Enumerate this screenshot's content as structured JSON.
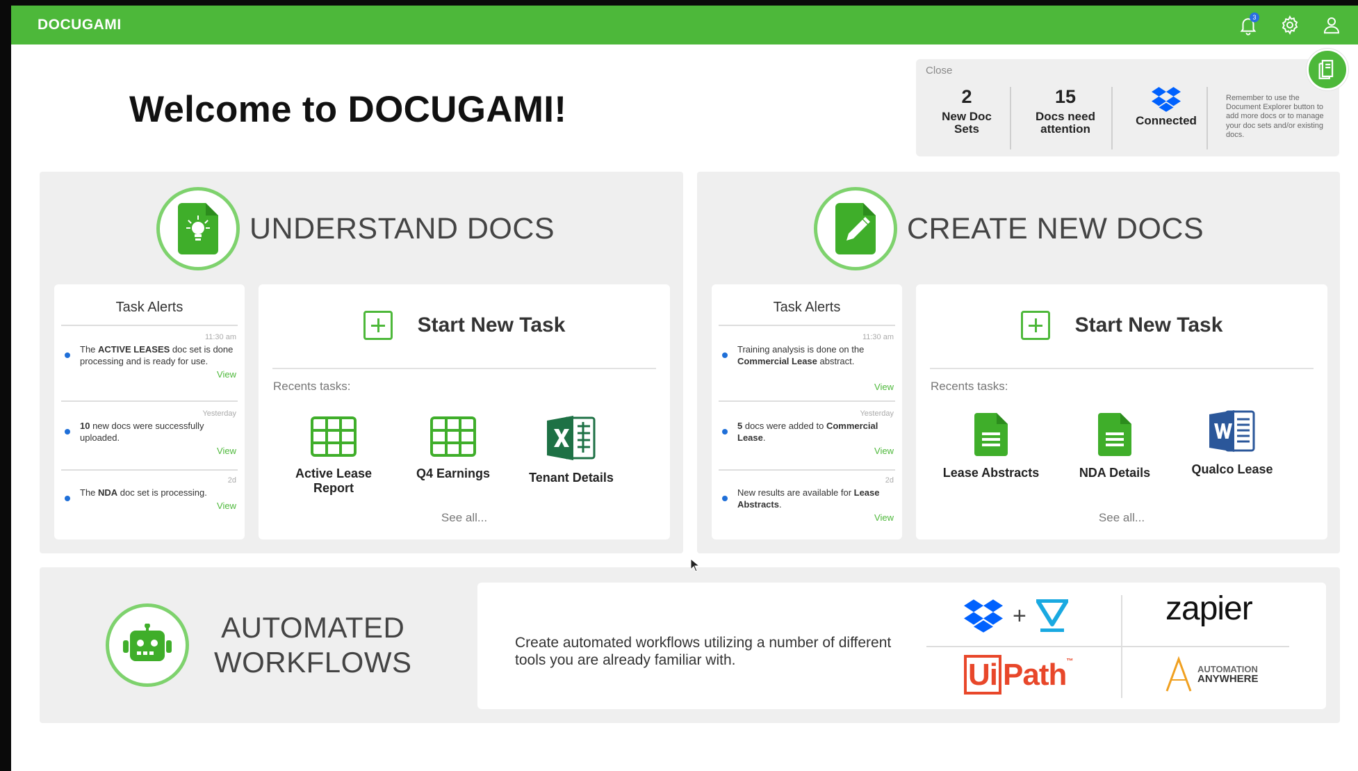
{
  "app": {
    "brand": "DOCUGAMI",
    "notification_count": "3"
  },
  "welcome": {
    "title": "Welcome to DOCUGAMI!"
  },
  "stats": {
    "close_label": "Close",
    "new_doc_sets": {
      "value": "2",
      "label": "New Doc Sets"
    },
    "docs_attention": {
      "value": "15",
      "label": "Docs need attention"
    },
    "dropbox": {
      "label": "Connected"
    },
    "note": "Remember to use the Document Explorer button to add more docs or to manage your doc sets and/or existing docs."
  },
  "understand": {
    "title": "UNDERSTAND DOCS",
    "alerts_title": "Task Alerts",
    "alerts": [
      {
        "time": "11:30 am",
        "pre": "The ",
        "bold": "ACTIVE LEASES",
        "post": " doc set is done processing and is ready for use.",
        "view": "View"
      },
      {
        "time": "Yesterday",
        "pre": "",
        "bold": "10",
        "post": " new docs were successfully uploaded.",
        "view": "View"
      },
      {
        "time": "2d",
        "pre": "The ",
        "bold": "NDA",
        "post": " doc set is processing.",
        "view": "View"
      }
    ],
    "start_label": "Start New Task",
    "recents_label": "Recents tasks:",
    "recents": [
      "Active Lease Report",
      "Q4 Earnings",
      "Tenant Details"
    ],
    "see_all": "See all..."
  },
  "create": {
    "title": "CREATE NEW DOCS",
    "alerts_title": "Task Alerts",
    "alerts": [
      {
        "time": "11:30 am",
        "pre": "Training analysis is done on the ",
        "bold": "Commercial Lease",
        "post": " abstract.",
        "view": "View"
      },
      {
        "time": "Yesterday",
        "pre": "",
        "bold": "5",
        "post": " docs were added to ",
        "bold2": "Commercial Lease",
        "post2": ".",
        "view": "View"
      },
      {
        "time": "2d",
        "pre": "New results are available for ",
        "bold": "Lease Abstracts",
        "post": ".",
        "view": "View"
      }
    ],
    "start_label": "Start New Task",
    "recents_label": "Recents tasks:",
    "recents": [
      "Lease Abstracts",
      "NDA Details",
      "Qualco Lease"
    ],
    "see_all": "See all..."
  },
  "automated": {
    "title_line1": "AUTOMATED",
    "title_line2": "WORKFLOWS",
    "description": "Create automated workflows utilizing a number of different tools you are already familiar with.",
    "logos": {
      "plus": "+",
      "zapier": "zapier",
      "uipath_ui": "Ui",
      "uipath_path": "Path",
      "uipath_tm": "™",
      "aa_line1": "AUTOMATION",
      "aa_line2": "ANYWHERE"
    }
  },
  "colors": {
    "brand_green": "#4db83a",
    "light_green": "#7ed26d",
    "bullet_blue": "#1f6fd8",
    "excel_green": "#1e7145",
    "word_blue": "#2b579a",
    "uipath_orange": "#e8472a",
    "dropbox_blue": "#0061fe"
  }
}
